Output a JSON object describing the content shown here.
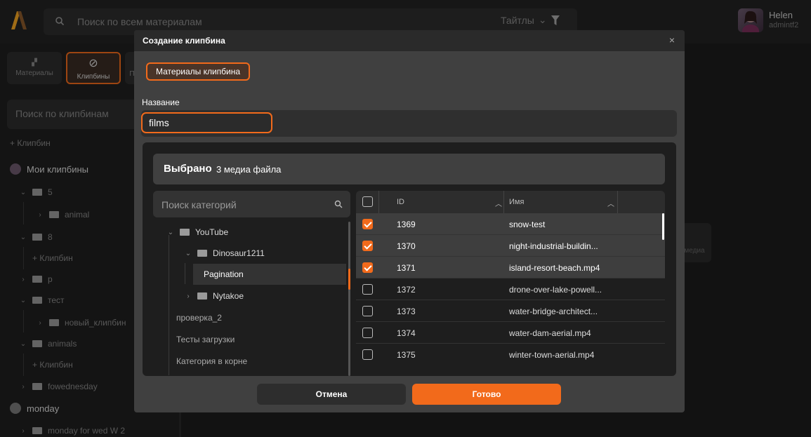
{
  "topbar": {
    "search_placeholder": "Поиск по всем материалам",
    "titles_filter": "Тайтлы",
    "user_name": "Helen",
    "user_login": "admintf2"
  },
  "sidebar": {
    "tabs": [
      "Материалы",
      "Клипбины",
      "П"
    ],
    "search_placeholder": "Поиск по клипбинам",
    "add_label": "+ Клипбин",
    "my_clipbins": "Мои клипбины",
    "tree": [
      "5",
      "animal",
      "8",
      "+ Клипбин",
      "p",
      "тест",
      "новый_клипбин",
      "animals",
      "+ Клипбин",
      "fowednesday"
    ],
    "monday_user": "monday",
    "monday_item": "monday for wed W 2"
  },
  "background": {
    "media_label": "медиа"
  },
  "modal": {
    "title": "Создание клипбина",
    "close": "×",
    "tab_label": "Материалы клипбина",
    "name_label": "Название",
    "name_value": "films",
    "selected_bold": "Выбрано",
    "selected_count": "3 медиа файла",
    "category_search_placeholder": "Поиск категорий",
    "categories": [
      "YouTube",
      "Dinosaur1211",
      "Pagination",
      "Nytakoe",
      "проверка_2",
      "Тесты загрузки",
      "Категория в корне"
    ],
    "table": {
      "col_id": "ID",
      "col_name": "Имя",
      "rows": [
        {
          "id": "1369",
          "name": "snow-test",
          "checked": true
        },
        {
          "id": "1370",
          "name": "night-industrial-buildin...",
          "checked": true
        },
        {
          "id": "1371",
          "name": "island-resort-beach.mp4",
          "checked": true
        },
        {
          "id": "1372",
          "name": "drone-over-lake-powell...",
          "checked": false
        },
        {
          "id": "1373",
          "name": "water-bridge-architect...",
          "checked": false
        },
        {
          "id": "1374",
          "name": "water-dam-aerial.mp4",
          "checked": false
        },
        {
          "id": "1375",
          "name": "winter-town-aerial.mp4",
          "checked": false
        }
      ]
    },
    "cancel_label": "Отмена",
    "done_label": "Готово"
  },
  "colors": {
    "accent": "#f26a1b",
    "modal_bg": "#404040",
    "panel_bg": "#1e1e1e"
  }
}
